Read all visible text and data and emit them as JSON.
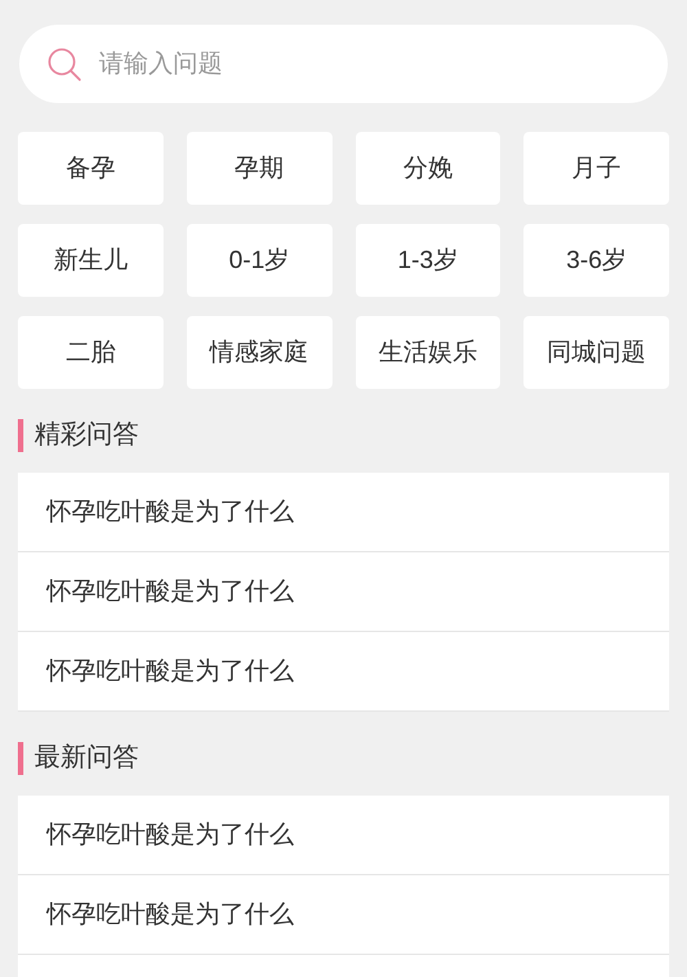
{
  "search": {
    "placeholder": "请输入问题"
  },
  "categories": [
    "备孕",
    "孕期",
    "分娩",
    "月子",
    "新生儿",
    "0-1岁",
    "1-3岁",
    "3-6岁",
    "二胎",
    "情感家庭",
    "生活娱乐",
    "同城问题"
  ],
  "sections": [
    {
      "title": "精彩问答",
      "questions": [
        "怀孕吃叶酸是为了什么",
        "怀孕吃叶酸是为了什么",
        "怀孕吃叶酸是为了什么"
      ]
    },
    {
      "title": "最新问答",
      "questions": [
        "怀孕吃叶酸是为了什么",
        "怀孕吃叶酸是为了什么"
      ]
    }
  ]
}
